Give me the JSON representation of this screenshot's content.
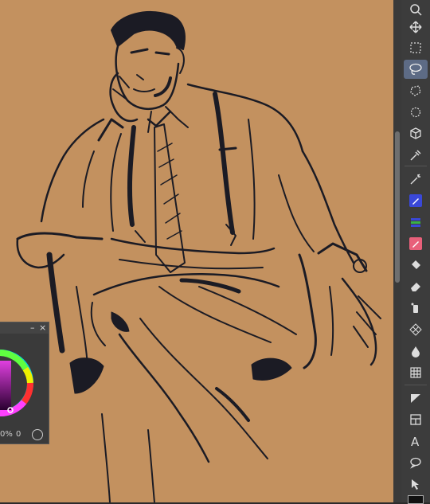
{
  "canvas": {
    "background": "#c3915f",
    "ink": "#1b1b24"
  },
  "toolbar": {
    "active_tool": "lasso",
    "tools": [
      "magnifier-icon",
      "move-icon",
      "rect-select-icon",
      "lasso-icon",
      "polygon-select-icon",
      "rotate-icon",
      "cube-icon",
      "eyedropper-icon",
      "magic-wand-icon",
      "pen-icon",
      "gradient-icon",
      "pencil-icon",
      "fill-icon",
      "eraser-icon",
      "blend-icon",
      "pattern-icon",
      "drop-icon",
      "grid-icon",
      "triangle-icon",
      "frame-icon",
      "text-icon",
      "speech-bubble-icon",
      "pointer-icon"
    ]
  },
  "palette": {
    "minimize_label": "–",
    "close_label": "×",
    "value_left": "0%",
    "value_right": "0"
  }
}
